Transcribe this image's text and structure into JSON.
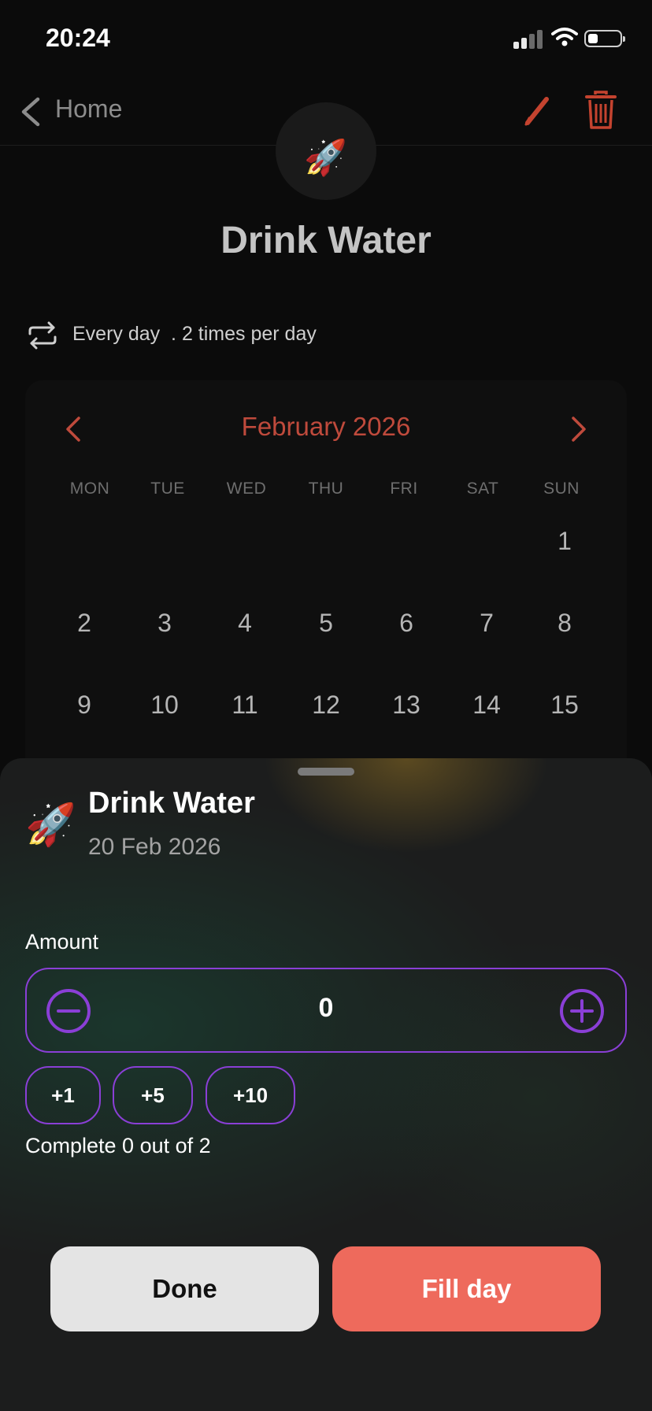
{
  "status_bar": {
    "time": "20:24"
  },
  "nav": {
    "back_label": "Home"
  },
  "habit": {
    "emoji": "🚀",
    "title": "Drink Water",
    "frequency": "Every day  . 2 times per day"
  },
  "calendar": {
    "month": "February 2026",
    "weekdays": [
      "MON",
      "TUE",
      "WED",
      "THU",
      "FRI",
      "SAT",
      "SUN"
    ],
    "weeks": [
      [
        "",
        "",
        "",
        "",
        "",
        "",
        "1"
      ],
      [
        "2",
        "3",
        "4",
        "5",
        "6",
        "7",
        "8"
      ],
      [
        "9",
        "10",
        "11",
        "12",
        "13",
        "14",
        "15"
      ]
    ]
  },
  "sheet": {
    "emoji": "🚀",
    "title": "Drink Water",
    "date": "20 Feb 2026",
    "amount_label": "Amount",
    "amount_value": "0",
    "quick_add": [
      "+1",
      "+5",
      "+10"
    ],
    "complete_text": "Complete 0 out of 2",
    "done_label": "Done",
    "fill_label": "Fill day"
  },
  "colors": {
    "accent": "#bf4a3c",
    "stepper_border": "#8a3fd6",
    "fill_button": "#ee6a5c"
  }
}
